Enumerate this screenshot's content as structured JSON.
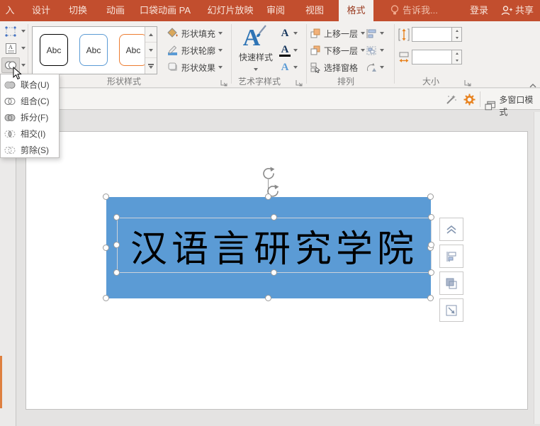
{
  "tabs": {
    "items": [
      {
        "label": "入"
      },
      {
        "label": "设计"
      },
      {
        "label": "切换"
      },
      {
        "label": "动画"
      },
      {
        "label": "口袋动画 PA"
      },
      {
        "label": "幻灯片放映"
      },
      {
        "label": "审阅"
      },
      {
        "label": "视图"
      },
      {
        "label": "格式"
      }
    ],
    "active_tab": "格式",
    "tell_me": "告诉我...",
    "sign_in": "登录",
    "share": "共享"
  },
  "ribbon": {
    "shape_styles": {
      "label": "形状样式",
      "thumbs": [
        "Abc",
        "Abc",
        "Abc"
      ],
      "fill": "形状填充",
      "outline": "形状轮廓",
      "effects": "形状效果"
    },
    "wordart": {
      "label": "艺术字样式",
      "quick_styles": "快速样式",
      "icon_letter": "A"
    },
    "arrange": {
      "label": "排列",
      "bring_forward": "上移一层",
      "send_backward": "下移一层",
      "selection_pane": "选择窗格"
    },
    "size": {
      "label": "大小",
      "height_value": "",
      "width_value": ""
    }
  },
  "merge_menu": {
    "items": [
      {
        "label": "联合(U)"
      },
      {
        "label": "组合(C)"
      },
      {
        "label": "拆分(F)"
      },
      {
        "label": "相交(I)"
      },
      {
        "label": "剪除(S)"
      }
    ]
  },
  "plugin_bar": {
    "multi_window": "多窗口模式"
  },
  "slide": {
    "shape_text": "汉语言研究学院"
  },
  "colors": {
    "accent_red": "#C24E2E",
    "active_tab_text": "#9A3B20",
    "shape_blue": "#5B9BD5",
    "thumb_border_black": "#000000",
    "thumb_border_blue": "#5B9BD5",
    "thumb_border_orange": "#ED7D31",
    "gear_orange": "#E8821E"
  }
}
